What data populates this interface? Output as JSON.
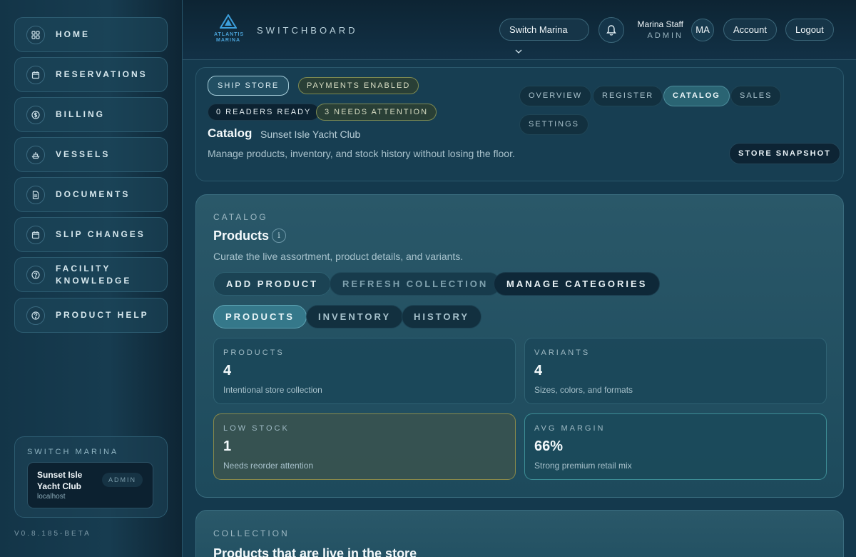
{
  "sidebar": {
    "items": [
      {
        "label": "HOME",
        "icon": "grid-icon"
      },
      {
        "label": "RESERVATIONS",
        "icon": "calendar-icon"
      },
      {
        "label": "BILLING",
        "icon": "dollar-icon"
      },
      {
        "label": "VESSELS",
        "icon": "boat-icon"
      },
      {
        "label": "DOCUMENTS",
        "icon": "document-icon"
      },
      {
        "label": "SLIP CHANGES",
        "icon": "calendar-icon"
      },
      {
        "label": "FACILITY KNOWLEDGE",
        "icon": "help-icon"
      },
      {
        "label": "PRODUCT HELP",
        "icon": "help-icon"
      }
    ],
    "switch": {
      "title": "SWITCH MARINA",
      "marina_name": "Sunset Isle Yacht Club",
      "host": "localhost",
      "role": "ADMIN"
    },
    "version": "V0.8.185-BETA"
  },
  "topbar": {
    "logo_line1": "ATLANTIS",
    "logo_line2": "MARINA",
    "brand": "SWITCHBOARD",
    "switch_marina": "Switch Marina",
    "user_name": "Marina Staff",
    "user_role": "ADMIN",
    "avatar": "MA",
    "account": "Account",
    "logout": "Logout"
  },
  "store": {
    "ship_store": "SHIP STORE",
    "payments": "PAYMENTS ENABLED",
    "readers": "0 READERS READY",
    "attention": "3 NEEDS ATTENTION",
    "title": "Catalog",
    "subtitle": "Sunset Isle Yacht Club",
    "description": "Manage products, inventory, and stock history without losing the floor.",
    "nav": [
      "OVERVIEW",
      "REGISTER",
      "CATALOG",
      "SALES",
      "SETTINGS"
    ],
    "snapshot": "STORE SNAPSHOT"
  },
  "catalog": {
    "eyebrow": "CATALOG",
    "title": "Products",
    "info": "i",
    "description": "Curate the live assortment, product details, and variants.",
    "actions": [
      "ADD PRODUCT",
      "REFRESH COLLECTION",
      "MANAGE CATEGORIES"
    ],
    "tabs": [
      "PRODUCTS",
      "INVENTORY",
      "HISTORY"
    ],
    "stats": [
      {
        "key": "PRODUCTS",
        "value": "4",
        "sub": "Intentional store collection"
      },
      {
        "key": "VARIANTS",
        "value": "4",
        "sub": "Sizes, colors, and formats"
      },
      {
        "key": "LOW STOCK",
        "value": "1",
        "sub": "Needs reorder attention"
      },
      {
        "key": "AVG MARGIN",
        "value": "66%",
        "sub": "Strong premium retail mix"
      }
    ]
  },
  "collection": {
    "eyebrow": "COLLECTION",
    "title": "Products that are live in the store"
  }
}
